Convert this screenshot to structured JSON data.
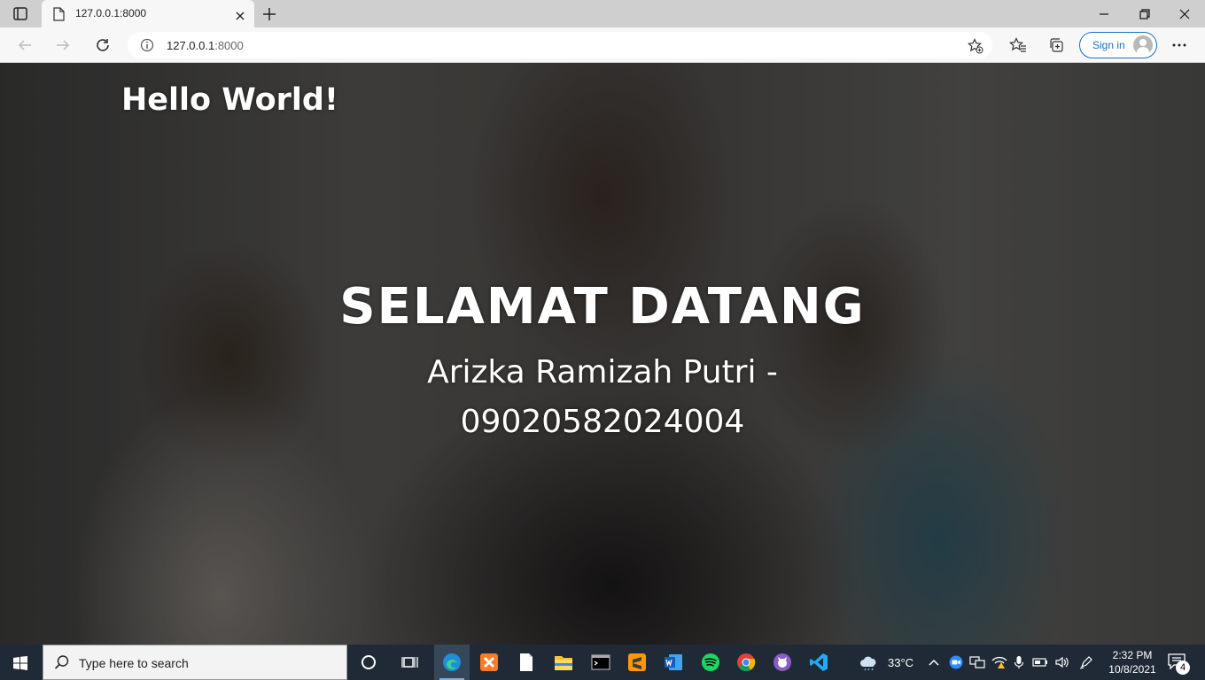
{
  "browser": {
    "tab": {
      "title": "127.0.0.1:8000"
    },
    "address": {
      "host": "127.0.0.1",
      "port": ":8000"
    },
    "signin_label": "Sign in"
  },
  "page": {
    "hello": "Hello World!",
    "welcome": "SELAMAT DATANG",
    "subtitle": "Arizka Ramizah Putri - 09020582024004"
  },
  "taskbar": {
    "search_placeholder": "Type here to search",
    "weather": "33°C",
    "time": "2:32 PM",
    "date": "10/8/2021",
    "notification_count": "4",
    "apps": [
      "task-view",
      "edge",
      "xampp",
      "file",
      "file-explorer",
      "terminal",
      "sublime-text",
      "word",
      "spotify",
      "chrome",
      "github-desktop",
      "vscode"
    ]
  },
  "colors": {
    "signin_accent": "#1a6fbf",
    "taskbar_bg": "#1f2a36"
  }
}
